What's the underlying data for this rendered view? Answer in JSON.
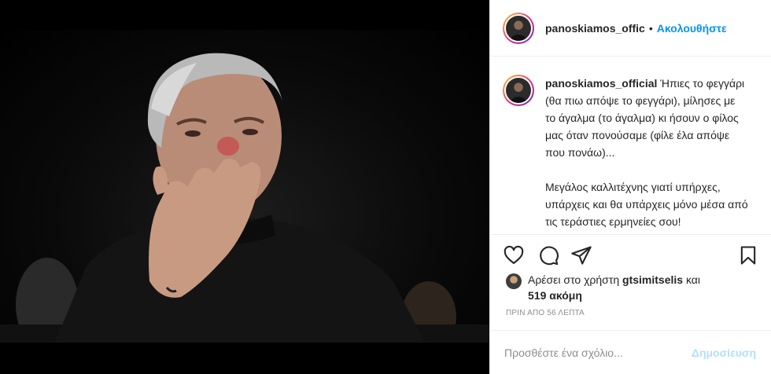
{
  "post": {
    "username": "panoskiamos_offic",
    "separator": "•",
    "follow_label": "Ακολουθήστε"
  },
  "caption": {
    "username": "panoskiamos_official",
    "paragraph1": "Ήπιες το φεγγάρι (θα πιω απόψε το φεγγάρι), μίλησες με το άγαλμα (το άγαλμα) κι ήσουν ο φίλος μας όταν πονούσαμε (φίλε έλα απόψε που πονάω)...",
    "paragraph2": "Μεγάλος καλλιτέχνης γιατί υπήρχες, υπάρχεις και θα υπάρχεις μόνο μέσα από τις τεράστιες ερμηνείες σου!"
  },
  "actions": {
    "like_icon": "heart-icon",
    "comment_icon": "comment-icon",
    "share_icon": "paper-plane-icon",
    "save_icon": "bookmark-icon"
  },
  "likes": {
    "prefix": "Αρέσει στο χρήστη",
    "user": "gtsimitselis",
    "conj": "και",
    "others": "519 ακόμη"
  },
  "timestamp": "ΠΡΙΝ ΑΠΟ 56 ΛΕΠΤΑ",
  "comment_box": {
    "placeholder": "Προσθέστε ένα σχόλιο...",
    "post_label": "Δημοσίευση"
  },
  "colors": {
    "accent": "#0095f6",
    "post_disabled": "#b2dffc",
    "muted": "#8e8e8e",
    "text": "#262626"
  }
}
